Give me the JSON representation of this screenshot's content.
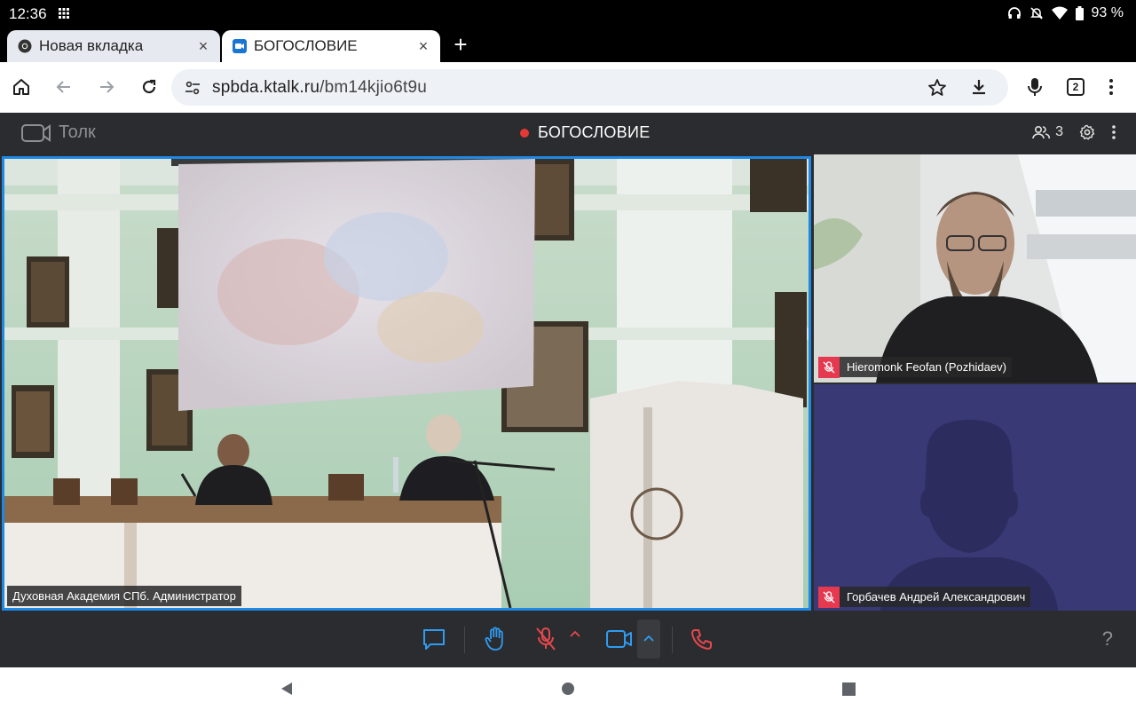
{
  "status_bar": {
    "time": "12:36",
    "battery": "93 %",
    "icons": [
      "grid-icon",
      "headphones-icon",
      "mute-icon",
      "wifi-icon",
      "battery-icon"
    ]
  },
  "tabs": [
    {
      "title": "Новая вкладка",
      "favicon": "chrome-icon",
      "active": false
    },
    {
      "title": "БОГОСЛОВИЕ",
      "favicon": "ktalk-icon",
      "active": true
    }
  ],
  "toolbar": {
    "url_domain": "spbda.ktalk.ru",
    "url_path": "/bm14kjio6t9u",
    "tab_count": "2"
  },
  "talk": {
    "brand": "Толк",
    "meeting_title": "БОГОСЛОВИЕ",
    "participants_count": "3"
  },
  "videos": {
    "main_name": "Духовная Академия СПб. Администратор",
    "tile1_name": "Hieromonk Feofan (Pozhidaev)",
    "tile2_name": "Горбачев Андрей Александрович"
  },
  "controls": {
    "help": "?",
    "accent_blue": "#2f9cf2",
    "accent_red": "#e5484d"
  }
}
